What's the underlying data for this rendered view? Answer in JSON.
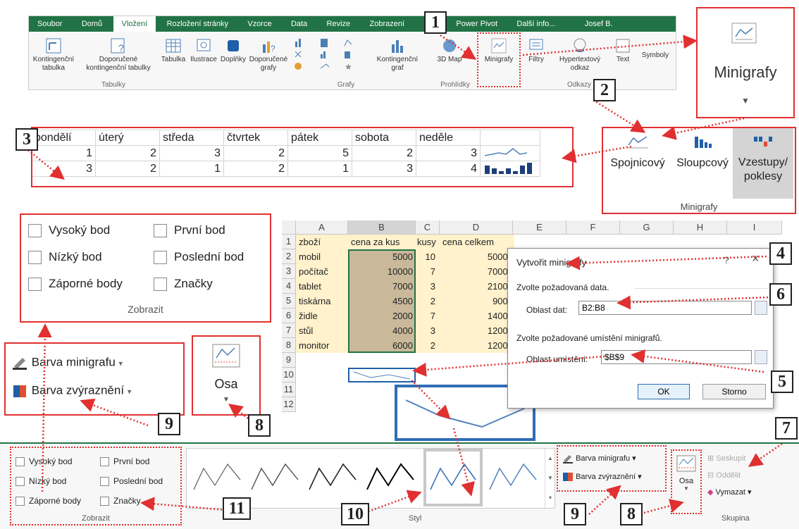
{
  "ribbon": {
    "tabs": [
      "Soubor",
      "Domů",
      "Vložení",
      "Rozložení stránky",
      "Vzorce",
      "Data",
      "Revize",
      "Zobrazení",
      "Power Pivot",
      "Další info...",
      "Josef B."
    ],
    "buttons": {
      "pivot": "Kontingenční tabulka",
      "rec_pivot": "Doporučené kontingenční tabulky",
      "table": "Tabulka",
      "illustrations": "Ilustrace",
      "addins": "Doplňky",
      "rec_charts": "Doporučené grafy",
      "pivot_chart": "Kontingenční graf",
      "map3d": "3D Map",
      "sparklines": "Minigrafy",
      "filters": "Filtry",
      "hyperlink": "Hypertextový odkaz",
      "text": "Text",
      "symbols": "Symboly"
    },
    "groups": {
      "tables": "Tabulky",
      "charts": "Grafy",
      "tours": "Prohlídky",
      "links": "Odkazy"
    }
  },
  "zoom_minigrafy": {
    "label": "Minigrafy"
  },
  "sparkline_types": {
    "items": [
      "Spojnicový",
      "Sloupcový",
      "Vzestupy/ poklesy"
    ],
    "group": "Minigrafy"
  },
  "week_table": {
    "headers": [
      "pondělí",
      "úterý",
      "středa",
      "čtvrtek",
      "pátek",
      "sobota",
      "neděle"
    ],
    "rows": [
      [
        1,
        2,
        3,
        2,
        5,
        2,
        3
      ],
      [
        3,
        2,
        1,
        2,
        1,
        3,
        4
      ]
    ]
  },
  "show_panel": {
    "items": [
      "Vysoký bod",
      "První bod",
      "Nízký bod",
      "Poslední bod",
      "Záporné body",
      "Značky"
    ],
    "group": "Zobrazit"
  },
  "colors_panel": {
    "line_color": "Barva minigrafu",
    "highlight_color": "Barva zvýraznění"
  },
  "axis": {
    "label": "Osa"
  },
  "sheet": {
    "columns": [
      "A",
      "B",
      "C",
      "D",
      "E",
      "F",
      "G",
      "H",
      "I"
    ],
    "row_numbers": [
      "1",
      "2",
      "3",
      "4",
      "5",
      "6",
      "7",
      "8",
      "9",
      "10",
      "11",
      "12"
    ],
    "header_row": [
      "zboží",
      "cena za kus",
      "kusy",
      "cena celkem"
    ],
    "rows": [
      [
        "mobil",
        "5000",
        "10",
        "50000"
      ],
      [
        "počítač",
        "10000",
        "7",
        "70000"
      ],
      [
        "tablet",
        "7000",
        "3",
        "21000"
      ],
      [
        "tiskárna",
        "4500",
        "2",
        "9000"
      ],
      [
        "židle",
        "2000",
        "7",
        "14000"
      ],
      [
        "stůl",
        "4000",
        "3",
        "12000"
      ],
      [
        "monitor",
        "6000",
        "2",
        "12000"
      ]
    ]
  },
  "dialog": {
    "title": "Vytvořit minigrafy",
    "help": "?",
    "close": "×",
    "data_section": "Zvolte požadovaná data.",
    "data_label": "Oblast dat:",
    "data_value": "B2:B8",
    "location_section": "Zvolte požadované umístění minigrafů.",
    "location_label": "Oblast umístění:",
    "location_value": "$B$9",
    "ok": "OK",
    "cancel": "Storno"
  },
  "bottom_ribbon": {
    "show_items": [
      "Vysoký bod",
      "První bod",
      "Nízký bod",
      "Poslední bod",
      "Záporné body",
      "Značky"
    ],
    "show_group": "Zobrazit",
    "style_group": "Styl",
    "line_color": "Barva minigrafu",
    "highlight_color": "Barva zvýraznění",
    "axis": "Osa",
    "group_btn": "Seskupit",
    "ungroup_btn": "Oddělit",
    "clear_btn": "Vymazat",
    "group_section": "Skupina"
  },
  "callouts": [
    "1",
    "2",
    "3",
    "4",
    "5",
    "6",
    "7",
    "8",
    "9",
    "10",
    "11",
    "8",
    "9"
  ],
  "colors": {
    "excel_green": "#217346",
    "red": "#e03030",
    "sparkline_blue": "#4f81bd",
    "dark_blue": "#1f3f7a",
    "highlight": "#fff2cc"
  }
}
